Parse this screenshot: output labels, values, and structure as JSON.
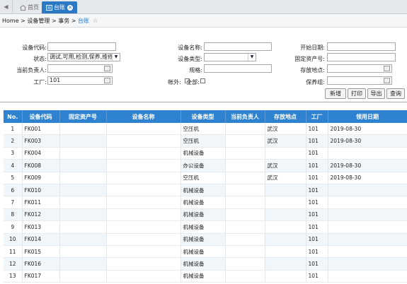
{
  "tabs": {
    "home_label": "首页",
    "active_label": "台账"
  },
  "breadcrumb": {
    "home": "Home",
    "sep": ">",
    "level1": "设备管理",
    "level2": "事务",
    "current": "台账"
  },
  "form": {
    "device_code": {
      "label": "设备代码:",
      "value": ""
    },
    "device_name": {
      "label": "设备名称:",
      "value": ""
    },
    "start_date": {
      "label": "开始日期:",
      "value": ""
    },
    "status": {
      "label": "状态:",
      "value": "调试,可用,检测,保养,维修,报"
    },
    "device_type": {
      "label": "设备类型:",
      "value": ""
    },
    "fixed_asset_no": {
      "label": "固定资产号:",
      "value": ""
    },
    "current_owner": {
      "label": "当前负责人:",
      "value": ""
    },
    "spec": {
      "label": "规格:",
      "value": ""
    },
    "storage_location": {
      "label": "存放地点:",
      "value": ""
    },
    "factory": {
      "label": "工厂:",
      "value": "101"
    },
    "account_outside": {
      "label": "帐外:"
    },
    "all": {
      "label": "全部:"
    },
    "maintenance_group": {
      "label": "保养组:",
      "value": ""
    }
  },
  "buttons": {
    "add": "新增",
    "print": "打印",
    "export": "导出",
    "query": "查询"
  },
  "table": {
    "headers": [
      "No.",
      "设备代码",
      "固定资产号",
      "设备名称",
      "设备类型",
      "当前负责人",
      "存放地点",
      "工厂",
      "领用日期"
    ],
    "rows": [
      [
        "1",
        "FK001",
        "",
        "",
        "空压机",
        "",
        "武汉",
        "101",
        "2019-08-30"
      ],
      [
        "2",
        "FK003",
        "",
        "",
        "空压机",
        "",
        "武汉",
        "101",
        "2019-08-30"
      ],
      [
        "3",
        "FK004",
        "",
        "",
        "机械设备",
        "",
        "",
        "101",
        ""
      ],
      [
        "4",
        "FK008",
        "",
        "",
        "办公设备",
        "",
        "武汉",
        "101",
        "2019-08-30"
      ],
      [
        "5",
        "FK009",
        "",
        "",
        "空压机",
        "",
        "武汉",
        "101",
        "2019-08-30"
      ],
      [
        "6",
        "FK010",
        "",
        "",
        "机械设备",
        "",
        "",
        "101",
        ""
      ],
      [
        "7",
        "FK011",
        "",
        "",
        "机械设备",
        "",
        "",
        "101",
        ""
      ],
      [
        "8",
        "FK012",
        "",
        "",
        "机械设备",
        "",
        "",
        "101",
        ""
      ],
      [
        "9",
        "FK013",
        "",
        "",
        "机械设备",
        "",
        "",
        "101",
        ""
      ],
      [
        "10",
        "FK014",
        "",
        "",
        "机械设备",
        "",
        "",
        "101",
        ""
      ],
      [
        "11",
        "FK015",
        "",
        "",
        "机械设备",
        "",
        "",
        "101",
        ""
      ],
      [
        "12",
        "FK016",
        "",
        "",
        "机械设备",
        "",
        "",
        "101",
        ""
      ],
      [
        "13",
        "FK017",
        "",
        "",
        "机械设备",
        "",
        "",
        "101",
        ""
      ]
    ]
  },
  "colors": {
    "accent": "#2e82cf",
    "tab_active": "#2b78c5",
    "row_alt": "#f1f6fb"
  }
}
